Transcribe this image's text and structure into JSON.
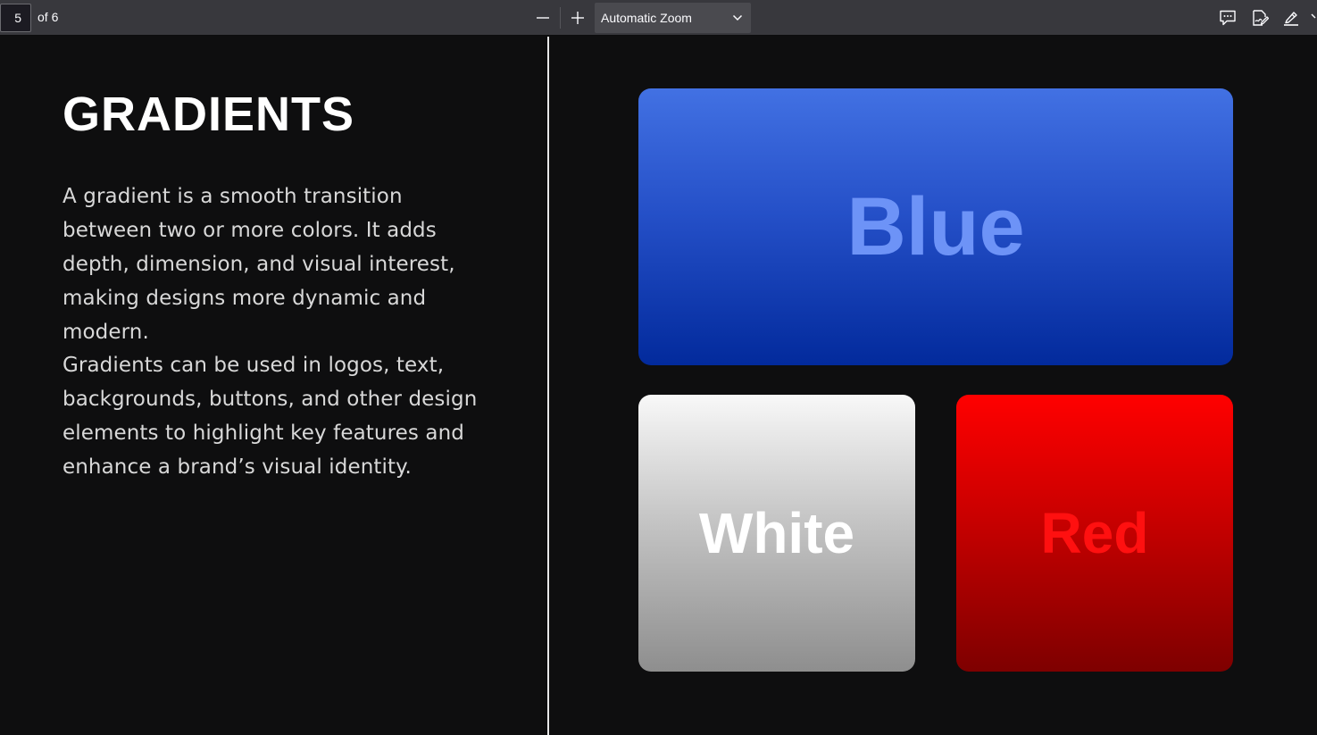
{
  "toolbar": {
    "page_number": "5",
    "page_count": "of 6",
    "zoom_value": "Automatic Zoom"
  },
  "slide": {
    "title": "GRADIENTS",
    "paragraph1": "A gradient is a smooth transition between two or more colors. It adds depth, dimension, and visual interest, making designs more dynamic and modern.",
    "paragraph2": "Gradients can be used in logos, text, backgrounds, buttons, and other design elements to highlight key features and enhance a brand’s visual identity."
  },
  "cards": {
    "blue": {
      "label": "Blue",
      "text_color": "#6d93f7",
      "gradient": [
        "#4271e3",
        "#022a9c"
      ]
    },
    "white": {
      "label": "White",
      "text_color": "#ffffff",
      "gradient": [
        "#f8f8f8",
        "#8e8e8e"
      ]
    },
    "red": {
      "label": "Red",
      "text_color": "#ff1010",
      "gradient": [
        "#ff0000",
        "#7e0000"
      ]
    }
  },
  "icons": {
    "zoom_out": "minus-icon",
    "zoom_in": "plus-icon",
    "zoom_dropdown": "chevron-down-icon",
    "comment": "comment-icon",
    "sign": "signature-icon",
    "highlight": "highlighter-icon"
  },
  "colors": {
    "toolbar_bg": "#38383d",
    "document_bg": "#0e0e0f",
    "divider": "#e8e8e8"
  }
}
